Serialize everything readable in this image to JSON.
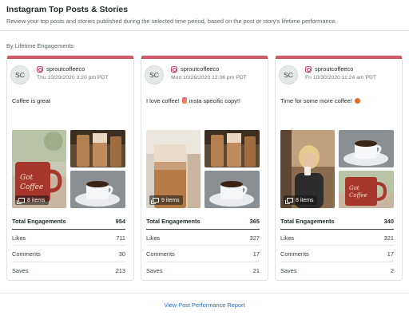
{
  "header": {
    "title": "Instagram Top Posts & Stories",
    "subtitle": "Review your top posts and stories published during the selected time period, based on the post or story's lifetime performance."
  },
  "section_label": "By Lifetime Engagements",
  "colors": {
    "card_accent": "#d05a6a",
    "instagram": "#d0426a",
    "link": "#2a6cbf"
  },
  "cards": [
    {
      "avatar": "SC",
      "handle": "sproutcoffeeco",
      "date": "Thu 10/29/2020 3:20 pm PDT",
      "caption": "Coffee is great",
      "items_count": "8 items",
      "main_image": "mug",
      "metrics": [
        {
          "label": "Total Engagements",
          "value": "954"
        },
        {
          "label": "Likes",
          "value": "711"
        },
        {
          "label": "Comments",
          "value": "30"
        },
        {
          "label": "Saves",
          "value": "213"
        }
      ]
    },
    {
      "avatar": "SC",
      "handle": "sproutcoffeeco",
      "date": "Mon 10/26/2020 12:06 pm PDT",
      "caption_before": "I love coffee!",
      "caption_after": "insta specific copy!!",
      "items_count": "9 items",
      "main_image": "iced",
      "metrics": [
        {
          "label": "Total Engagements",
          "value": "365"
        },
        {
          "label": "Likes",
          "value": "327"
        },
        {
          "label": "Comments",
          "value": "17"
        },
        {
          "label": "Saves",
          "value": "21"
        }
      ]
    },
    {
      "avatar": "SC",
      "handle": "sproutcoffeeco",
      "date": "Fri 10/30/2020 11:24 am PDT",
      "caption": "Time for some more coffee!",
      "items_count": "8 items",
      "main_image": "person",
      "metrics": [
        {
          "label": "Total Engagements",
          "value": "340"
        },
        {
          "label": "Likes",
          "value": "321"
        },
        {
          "label": "Comments",
          "value": "17"
        },
        {
          "label": "Saves",
          "value": "2"
        }
      ]
    }
  ],
  "footer": {
    "report_link": "View Post Performance Report"
  }
}
